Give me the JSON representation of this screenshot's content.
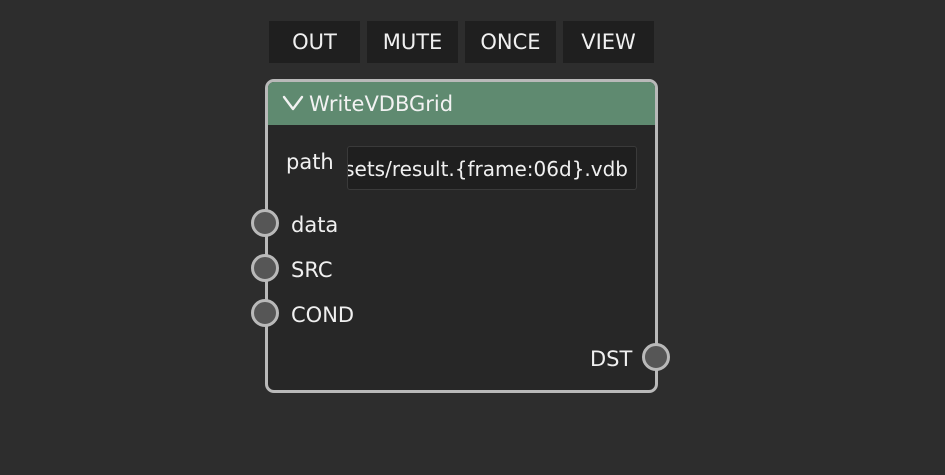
{
  "toolbar": {
    "buttons": [
      {
        "label": "OUT"
      },
      {
        "label": "MUTE"
      },
      {
        "label": "ONCE"
      },
      {
        "label": "VIEW"
      }
    ]
  },
  "node": {
    "title": "WriteVDBGrid",
    "header_color": "#5f8a70",
    "collapse_icon": "chevron-down-icon",
    "params": [
      {
        "label": "path",
        "value": "sets/result.{frame:06d}.vdb"
      }
    ],
    "inputs": [
      {
        "label": "data"
      },
      {
        "label": "SRC"
      },
      {
        "label": "COND"
      }
    ],
    "outputs": [
      {
        "label": "DST"
      }
    ]
  }
}
